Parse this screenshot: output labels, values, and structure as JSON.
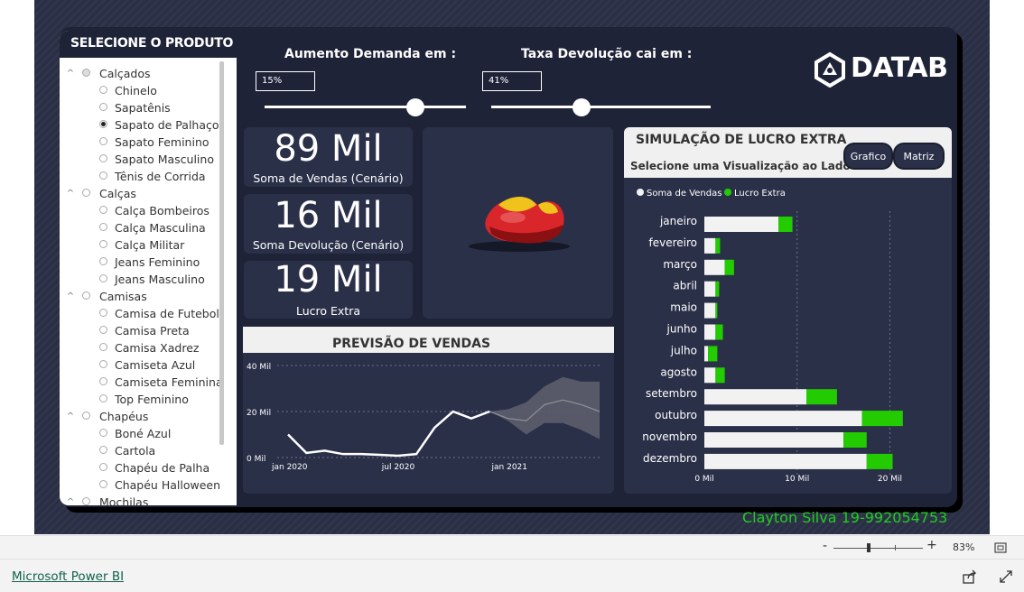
{
  "slicer": {
    "title": "SELECIONE O PRODUTO",
    "items": [
      {
        "level": 0,
        "label": "Calçados",
        "state": "partial",
        "expanded": true
      },
      {
        "level": 1,
        "label": "Chinelo",
        "state": "off"
      },
      {
        "level": 1,
        "label": "Sapatênis",
        "state": "off"
      },
      {
        "level": 1,
        "label": "Sapato de Palhaço",
        "state": "on"
      },
      {
        "level": 1,
        "label": "Sapato Feminino",
        "state": "off"
      },
      {
        "level": 1,
        "label": "Sapato Masculino",
        "state": "off"
      },
      {
        "level": 1,
        "label": "Tênis de Corrida",
        "state": "off"
      },
      {
        "level": 0,
        "label": "Calças",
        "state": "off",
        "expanded": true
      },
      {
        "level": 1,
        "label": "Calça Bombeiros",
        "state": "off"
      },
      {
        "level": 1,
        "label": "Calça Masculina",
        "state": "off"
      },
      {
        "level": 1,
        "label": "Calça Militar",
        "state": "off"
      },
      {
        "level": 1,
        "label": "Jeans Feminino",
        "state": "off"
      },
      {
        "level": 1,
        "label": "Jeans Masculino",
        "state": "off"
      },
      {
        "level": 0,
        "label": "Camisas",
        "state": "off",
        "expanded": true
      },
      {
        "level": 1,
        "label": "Camisa de Futebol",
        "state": "off"
      },
      {
        "level": 1,
        "label": "Camisa Preta",
        "state": "off"
      },
      {
        "level": 1,
        "label": "Camisa Xadrez",
        "state": "off"
      },
      {
        "level": 1,
        "label": "Camiseta Azul",
        "state": "off"
      },
      {
        "level": 1,
        "label": "Camiseta Feminina",
        "state": "off"
      },
      {
        "level": 1,
        "label": "Top Feminino",
        "state": "off"
      },
      {
        "level": 0,
        "label": "Chapéus",
        "state": "off",
        "expanded": true
      },
      {
        "level": 1,
        "label": "Boné Azul",
        "state": "off"
      },
      {
        "level": 1,
        "label": "Cartola",
        "state": "off"
      },
      {
        "level": 1,
        "label": "Chapéu de Palha",
        "state": "off"
      },
      {
        "level": 1,
        "label": "Chapéu Halloween",
        "state": "off"
      },
      {
        "level": 0,
        "label": "Mochilas",
        "state": "off",
        "expanded": true
      }
    ]
  },
  "params": {
    "demand_label": "Aumento Demanda em :",
    "demand_value": "15%",
    "demand_fraction": 0.75,
    "return_label": "Taxa Devolução cai em :",
    "return_value": "41%",
    "return_fraction": 0.41
  },
  "logo": {
    "text": "DATAB"
  },
  "kpis": {
    "sales_value": "89 Mil",
    "sales_label": "Soma de Vendas (Cenário)",
    "returns_value": "16 Mil",
    "returns_label": "Soma Devolução (Cenário)",
    "profit_value": "19 Mil",
    "profit_label": "Lucro Extra"
  },
  "forecast": {
    "title": "PREVISÃO DE VENDAS",
    "chart_data": {
      "type": "line",
      "title": "PREVISÃO DE VENDAS",
      "y_ticks": [
        "40 Mil",
        "20 Mil",
        "0 Mil"
      ],
      "y_tick_values": [
        40,
        20,
        0
      ],
      "x_ticks": [
        "jan 2020",
        "jul 2020",
        "jan 2021"
      ],
      "x_tick_index": [
        0,
        6,
        12
      ],
      "ylim": [
        0,
        40
      ],
      "series": [
        {
          "values": [
            10,
            2,
            3,
            1.5,
            1.5,
            1.2,
            0.8,
            1.5,
            13,
            20,
            17,
            20
          ]
        }
      ],
      "forecast": {
        "x_index": [
          11,
          12,
          13,
          14,
          15,
          16,
          17
        ],
        "values": [
          20,
          17,
          16,
          23,
          25,
          23,
          20
        ],
        "upper": [
          20,
          21,
          24,
          31,
          35,
          33,
          33
        ],
        "lower": [
          20,
          16,
          10,
          15,
          15,
          12,
          8
        ]
      },
      "colors": {
        "line": "#ffffff",
        "forecast": "#8a8c96",
        "band": "#5c5e6c"
      }
    }
  },
  "simulation": {
    "title": "SIMULAÇÃO DE LUCRO EXTRA",
    "subtitle": "Selecione uma Visualização ao Lado :",
    "btn_chart": "Grafico",
    "btn_matrix": "Matriz",
    "chart_data": {
      "type": "bar",
      "orientation": "horizontal",
      "stacked": true,
      "categories": [
        "janeiro",
        "fevereiro",
        "março",
        "abril",
        "maio",
        "junho",
        "julho",
        "agosto",
        "setembro",
        "outubro",
        "novembro",
        "dezembro"
      ],
      "series": [
        {
          "name": "Soma de Vendas",
          "values": [
            8,
            1.2,
            2.2,
            1.2,
            1.2,
            1.2,
            0.4,
            1.2,
            11,
            17,
            15,
            17.5
          ],
          "color": "#f2f2f2"
        },
        {
          "name": "Lucro Extra",
          "values": [
            1.5,
            0.5,
            1,
            0.4,
            0.2,
            0.8,
            1,
            1,
            3.3,
            4.4,
            2.5,
            2.8
          ],
          "color": "#22cc00"
        }
      ],
      "x_ticks": [
        "0 Mil",
        "10 Mil",
        "20 Mil"
      ],
      "x_tick_values": [
        0,
        10,
        20
      ],
      "xlim": [
        0,
        22
      ],
      "legend": "top-left"
    }
  },
  "signature": "Clayton Silva 19-992054753",
  "statusbar": {
    "zoom_minus": "-",
    "zoom_plus": "+",
    "zoom": "83%"
  },
  "footer": {
    "link": "Microsoft Power BI"
  }
}
